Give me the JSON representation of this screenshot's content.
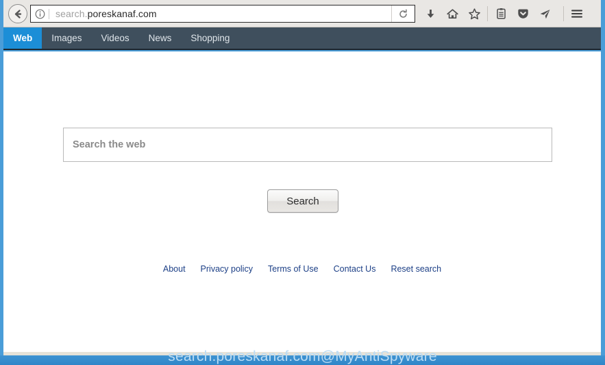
{
  "browser": {
    "url_scheme": "search.",
    "url_domain": "poreskanaf.com",
    "url_full": "search.poreskanaf.com",
    "back_icon": "back-arrow-icon",
    "info_icon": "info-circle-icon",
    "reload_icon": "reload-icon",
    "toolbar_icons": [
      {
        "name": "download-icon",
        "label": "Downloads"
      },
      {
        "name": "home-icon",
        "label": "Home"
      },
      {
        "name": "star-icon",
        "label": "Bookmark"
      },
      {
        "name": "library-icon",
        "label": "Library"
      },
      {
        "name": "pocket-icon",
        "label": "Pocket"
      },
      {
        "name": "send-icon",
        "label": "Send Tab"
      },
      {
        "name": "hamburger-menu-icon",
        "label": "Open menu"
      }
    ]
  },
  "nav": {
    "items": [
      {
        "label": "Web",
        "active": true
      },
      {
        "label": "Images",
        "active": false
      },
      {
        "label": "Videos",
        "active": false
      },
      {
        "label": "News",
        "active": false
      },
      {
        "label": "Shopping",
        "active": false
      }
    ]
  },
  "search": {
    "placeholder": "Search the web",
    "value": "",
    "button_label": "Search"
  },
  "footer": {
    "links": [
      {
        "label": "About"
      },
      {
        "label": "Privacy policy"
      },
      {
        "label": "Terms of Use"
      },
      {
        "label": "Contact Us"
      },
      {
        "label": "Reset search"
      }
    ]
  },
  "watermark": {
    "text": "search.poreskanaf.com@MyAntiSpyware"
  },
  "colors": {
    "nav_bg": "#3f4f5d",
    "nav_active": "#1c8ed7",
    "window_edge": "#4a9dd8",
    "link": "#1c3f86",
    "chrome_bg": "#e9e7e4"
  }
}
